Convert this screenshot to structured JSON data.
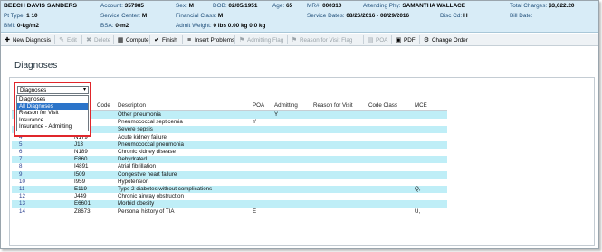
{
  "patient": {
    "name": "BEECH DAVIS SANDERS",
    "pt_type_label": "Pt Type:",
    "pt_type_value": "1  10",
    "bmi_label": "BMI:",
    "bmi_value": "0-kg/m2",
    "account_label": "Account:",
    "account_value": "357985",
    "service_center_label": "Service Center:",
    "service_center_value": "M",
    "bsa_label": "BSA:",
    "bsa_value": "0-m2",
    "sex_label": "Sex:",
    "sex_value": "M",
    "dob_label": "DOB:",
    "dob_value": "02/05/1951",
    "age_label": "Age:",
    "age_value": "65",
    "financial_class_label": "Financial Class:",
    "financial_class_value": "M",
    "admit_weight_label": "Admit Weight:",
    "admit_weight_value": "0 lbs 0.00 kg 0.0 kg",
    "mr_label": "MR#:",
    "mr_value": "000310",
    "attending_label": "Attending Phy:",
    "attending_value": "SAMANTHA WALLACE",
    "service_dates_label": "Service Dates:",
    "service_dates_value": "08/26/2016 - 08/29/2016",
    "disc_cd_label": "Disc Cd:",
    "disc_cd_value": "H",
    "total_charges_label": "Total Charges:",
    "total_charges_value": "$3,622.20",
    "bill_date_label": "Bill Date:"
  },
  "toolbar": [
    {
      "label": "New Diagnosis",
      "icon": "new-icon",
      "glyph": "✚",
      "enabled": true
    },
    {
      "label": "Edit",
      "icon": "edit-icon",
      "glyph": "✎",
      "enabled": false
    },
    {
      "label": "Delete",
      "icon": "delete-icon",
      "glyph": "✖",
      "enabled": false
    },
    {
      "label": "Compute",
      "icon": "compute-icon",
      "glyph": "▦",
      "enabled": true
    },
    {
      "label": "Finish",
      "icon": "finish-icon",
      "glyph": "✔",
      "enabled": true
    },
    {
      "label": "Insert Problems",
      "icon": "insert-problems-icon",
      "glyph": "≡",
      "enabled": true
    },
    {
      "label": "Admitting Flag",
      "icon": "flag-icon",
      "glyph": "⚑",
      "enabled": false
    },
    {
      "label": "Reason for Visit Flag",
      "icon": "flag-icon",
      "glyph": "⚑",
      "enabled": false
    },
    {
      "label": "POA",
      "icon": "poa-icon",
      "glyph": "▤",
      "enabled": false
    },
    {
      "label": "PDF",
      "icon": "pdf-icon",
      "glyph": "▣",
      "enabled": true
    },
    {
      "label": "Change Order",
      "icon": "change-order-icon",
      "glyph": "⚙",
      "enabled": true
    }
  ],
  "page_title": "Diagnoses",
  "filter": {
    "selected": "Diagnoses",
    "options": [
      "Diagnoses",
      "All Diagnoses",
      "Reason for Visit",
      "Insurance",
      "Insurance - Admitting"
    ],
    "highlighted_index": 1
  },
  "grid": {
    "columns": [
      "",
      "Code",
      "Description",
      "POA",
      "Admitting",
      "Reason for Visit",
      "Code Class",
      "MCE"
    ],
    "rows": [
      {
        "num": "",
        "code": "",
        "desc": "Other pneumonia",
        "poa": "",
        "adm": "Y",
        "mce": ""
      },
      {
        "num": "",
        "code": "",
        "desc": "Pneumococcal septicemia",
        "poa": "Y",
        "adm": "",
        "mce": ""
      },
      {
        "num": "",
        "code": "",
        "desc": "Severe sepsis",
        "poa": "",
        "adm": "",
        "mce": ""
      },
      {
        "num": "4",
        "code": "N179",
        "desc": "Acute kidney failure",
        "poa": "",
        "adm": "",
        "mce": ""
      },
      {
        "num": "5",
        "code": "J13",
        "desc": "Pneumococcal pneumonia",
        "poa": "",
        "adm": "",
        "mce": ""
      },
      {
        "num": "6",
        "code": "N189",
        "desc": "Chronic kidney disease",
        "poa": "",
        "adm": "",
        "mce": ""
      },
      {
        "num": "7",
        "code": "E860",
        "desc": "Dehydrated",
        "poa": "",
        "adm": "",
        "mce": ""
      },
      {
        "num": "8",
        "code": "I4891",
        "desc": "Atrial fibrillation",
        "poa": "",
        "adm": "",
        "mce": ""
      },
      {
        "num": "9",
        "code": "I509",
        "desc": "Congestive heart failure",
        "poa": "",
        "adm": "",
        "mce": ""
      },
      {
        "num": "10",
        "code": "I959",
        "desc": "Hypotension",
        "poa": "",
        "adm": "",
        "mce": ""
      },
      {
        "num": "11",
        "code": "E119",
        "desc": "Type 2 diabetes without complications",
        "poa": "",
        "adm": "",
        "mce": "Q,"
      },
      {
        "num": "12",
        "code": "J449",
        "desc": "Chronic airway obstruction",
        "poa": "",
        "adm": "",
        "mce": ""
      },
      {
        "num": "13",
        "code": "E6601",
        "desc": "Morbid obesity",
        "poa": "",
        "adm": "",
        "mce": ""
      },
      {
        "num": "14",
        "code": "Z8673",
        "desc": "Personal history of TIA",
        "poa": "E",
        "adm": "",
        "mce": "U,"
      }
    ]
  }
}
